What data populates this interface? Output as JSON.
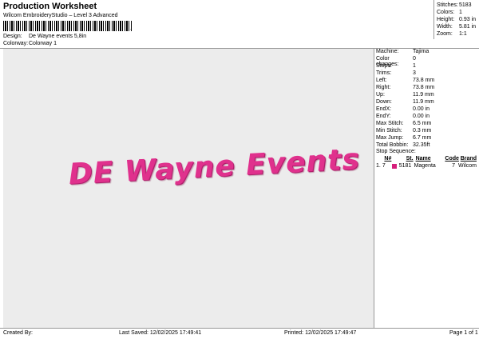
{
  "header": {
    "title": "Production Worksheet",
    "subtitle": "Wilcom EmbroideryStudio – Level 3 Advanced",
    "design_label": "Design:",
    "design_value": "De Wayne events 5,8in",
    "colorway_label": "Colorway:",
    "colorway_value": "Colorway 1"
  },
  "summary": [
    {
      "key": "Stitches:",
      "value": "5183"
    },
    {
      "key": "Colors:",
      "value": "1"
    },
    {
      "key": "Height:",
      "value": "0.93 in"
    },
    {
      "key": "Width:",
      "value": "5.81 in"
    },
    {
      "key": "Zoom:",
      "value": "1:1"
    }
  ],
  "design_text": "DE Wayne Events",
  "details": [
    {
      "key": "Machine:",
      "value": "Tajima"
    },
    {
      "key": "Color changes:",
      "value": "0"
    },
    {
      "key": "Stops:",
      "value": "1"
    },
    {
      "key": "Trims:",
      "value": "3"
    },
    {
      "key": "Left:",
      "value": "73.8 mm"
    },
    {
      "key": "Right:",
      "value": "73.8 mm"
    },
    {
      "key": "Up:",
      "value": "11.9 mm"
    },
    {
      "key": "Down:",
      "value": "11.9 mm"
    },
    {
      "key": "EndX:",
      "value": "0.00 in"
    },
    {
      "key": "EndY:",
      "value": "0.00 in"
    },
    {
      "key": "Max Stitch:",
      "value": "6.5 mm"
    },
    {
      "key": "Min Stitch:",
      "value": "0.3 mm"
    },
    {
      "key": "Max Jump:",
      "value": "6.7 mm"
    },
    {
      "key": "Total Bobbin:",
      "value": "32.35ft"
    }
  ],
  "stop_sequence": {
    "label": "Stop Sequence:",
    "headers": [
      "N#",
      "St.",
      "Name",
      "Code",
      "Brand"
    ],
    "rows": [
      {
        "index": "1.",
        "num": "7",
        "stitches": "5181",
        "name": "Magenta",
        "code": "7",
        "brand": "Wilcom",
        "color": "#d61e7b"
      }
    ]
  },
  "footer": {
    "created_by": "Created By:",
    "last_saved": "Last Saved: 12/02/2025 17:49:41",
    "printed": "Printed: 12/02/2025 17:49:47",
    "page": "Page 1 of 1"
  }
}
